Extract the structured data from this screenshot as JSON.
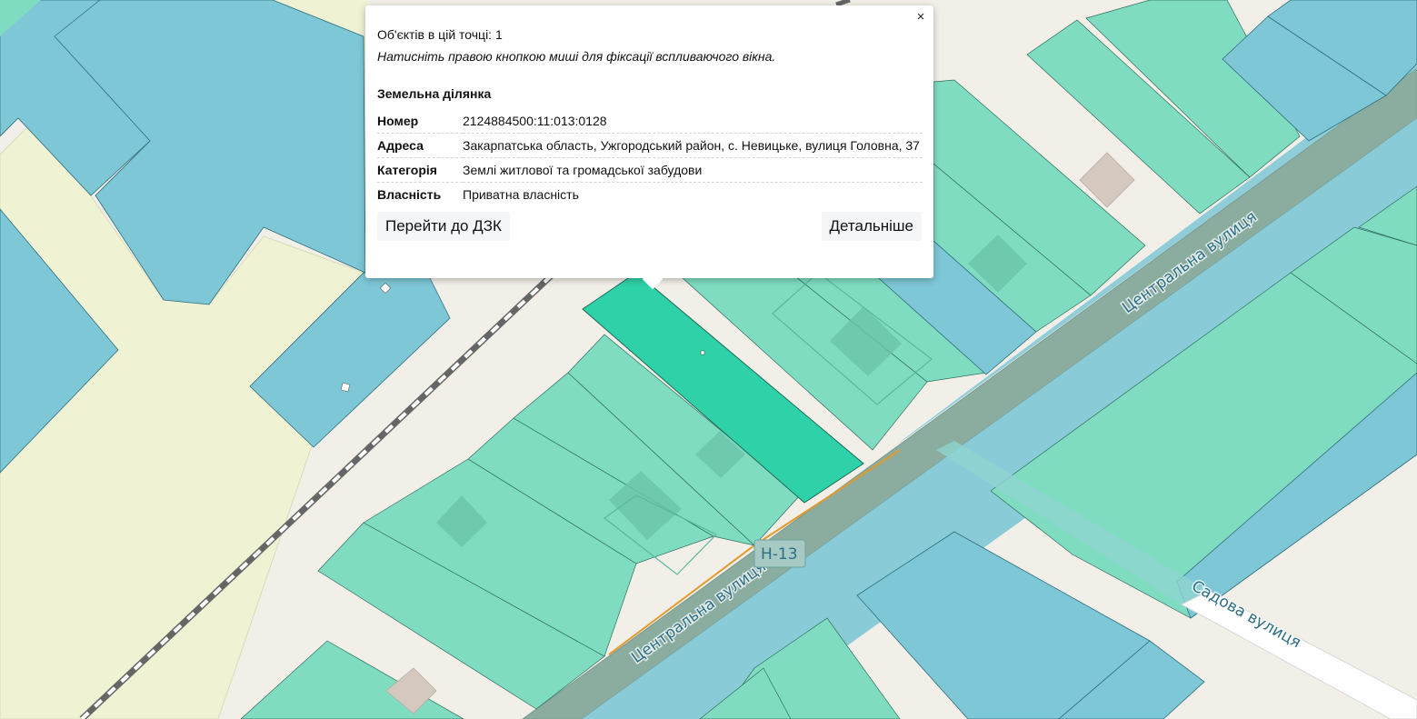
{
  "map": {
    "road_labels": [
      "Центральна вулиця",
      "Центральна вулиця",
      "Садова вулиця"
    ],
    "route_shield": "Н-13",
    "colors": {
      "background": "#f2efe9",
      "residential_parcel": "#7fdcc1",
      "selected_parcel": "#2ed1a8",
      "blue_parcel": "#7ec7d6",
      "yellow_area": "#f0f2d4",
      "road_band": "#8aada0",
      "building": "#d5c8bf",
      "railway": "#666666"
    }
  },
  "popup": {
    "objects_count_text": "Об'єктів в цій точці: 1",
    "hint_text": "Натисніть правою кнопкою миші для фіксації вспливаючого вікна.",
    "close_label": "×",
    "section_title": "Земельна ділянка",
    "fields": [
      {
        "label": "Номер",
        "value": "2124884500:11:013:0128"
      },
      {
        "label": "Адреса",
        "value": "Закарпатська область, Ужгородський район, с. Невицьке, вулиця Головна, 37"
      },
      {
        "label": "Категорія",
        "value": "Землі житлової та громадської забудови"
      },
      {
        "label": "Власність",
        "value": "Приватна власність"
      }
    ],
    "buttons": {
      "dzk": "Перейти до ДЗК",
      "details": "Детальніше"
    }
  }
}
